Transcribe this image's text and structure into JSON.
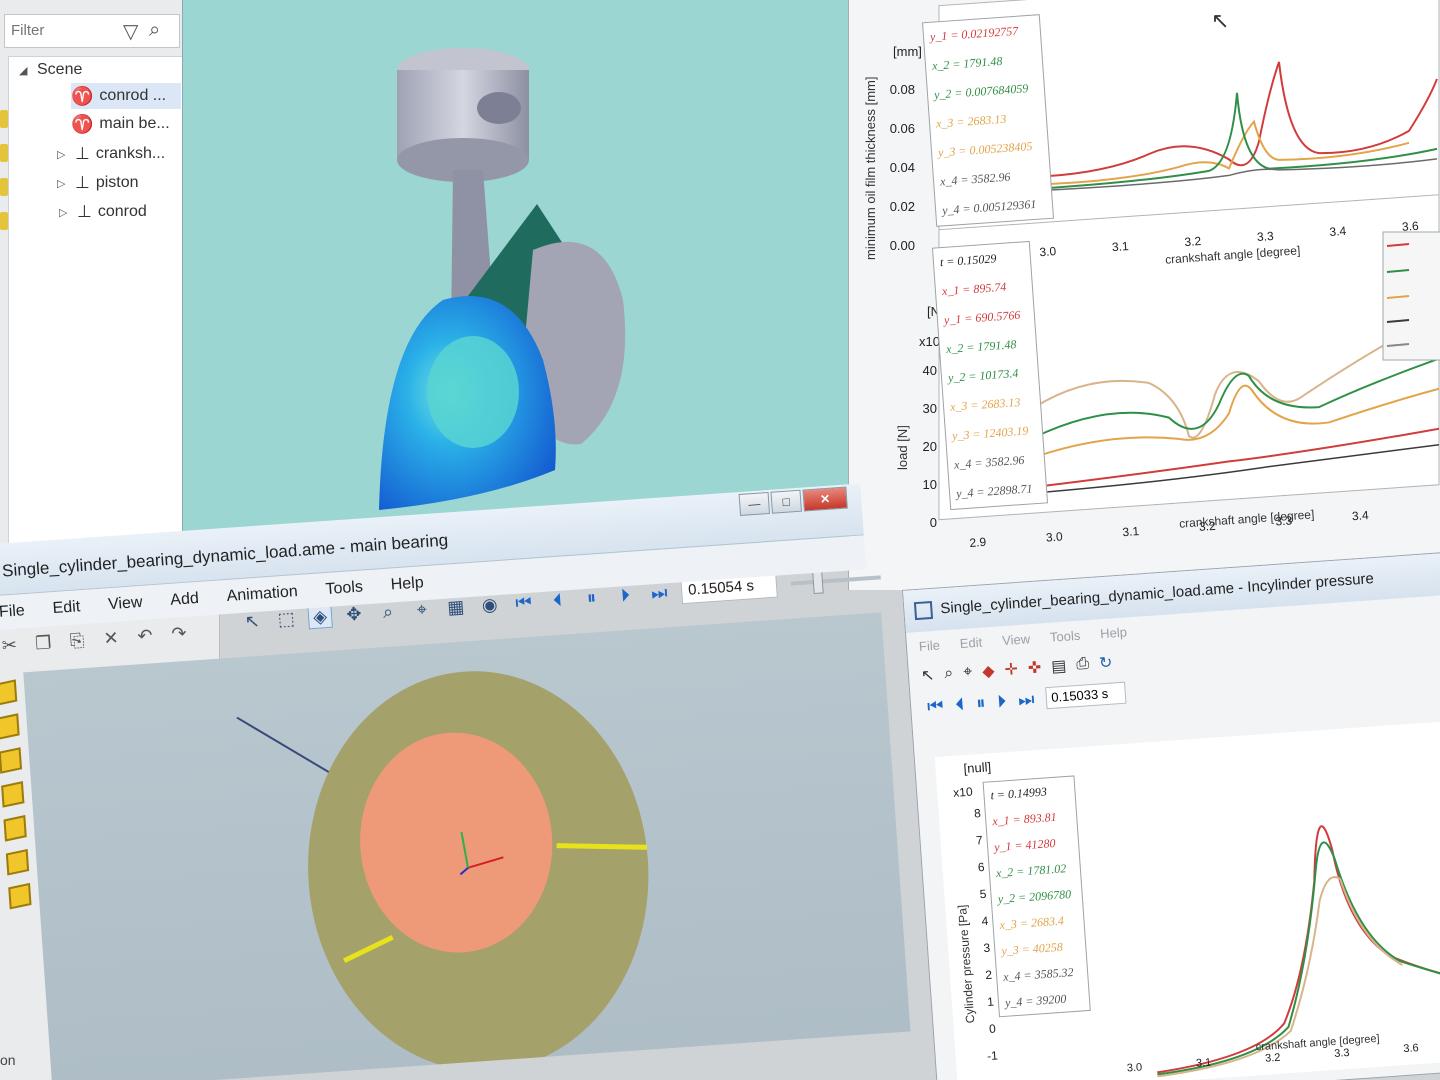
{
  "tree": {
    "filter_placeholder": "Filter",
    "items": [
      {
        "label": "Scene"
      },
      {
        "label": "conrod ..."
      },
      {
        "label": "main be..."
      },
      {
        "label": "cranksh..."
      },
      {
        "label": "piston"
      },
      {
        "label": "conrod"
      }
    ],
    "status": "on"
  },
  "main_window": {
    "title": "Single_cylinder_bearing_dynamic_load.ame - main bearing",
    "menu": [
      "File",
      "Edit",
      "View",
      "Add",
      "Animation",
      "Tools",
      "Help"
    ],
    "time": "0.15054 s",
    "slider_value": 0.28
  },
  "chart_top": {
    "ylabel": "minimum oil film thickness [mm]",
    "unit": "[mm]",
    "yticks": [
      "0.08",
      "0.06",
      "0.04",
      "0.02",
      "0.00"
    ],
    "xticks": [
      "3.0",
      "3.1",
      "3.2",
      "3.3",
      "3.4",
      "3.6"
    ],
    "xlabel": "crankshaft angle [degree]",
    "readout": [
      "y_1 = 0.02192757",
      "x_2 = 1791.48",
      "y_2 = 0.007684059",
      "x_3 = 2683.13",
      "y_3 = 0.005238405",
      "x_4 = 3582.96",
      "y_4 = 0.005129361"
    ]
  },
  "chart_mid": {
    "ylabel": "load [N]",
    "unit": "[N]",
    "scale": "x10",
    "yticks": [
      "40",
      "30",
      "20",
      "10",
      "0"
    ],
    "xticks": [
      "2.9",
      "3.0",
      "3.1",
      "3.2",
      "3.3",
      "3.4"
    ],
    "xlabel": "crankshaft angle [degree]",
    "readout": [
      "t = 0.15029",
      "x_1 = 895.74",
      "y_1 = 690.5766",
      "x_2 = 1791.48",
      "y_2 = 10173.4",
      "x_3 = 2683.13",
      "y_3 = 12403.19",
      "x_4 = 3582.96",
      "y_4 = 22898.71"
    ]
  },
  "pressure_window": {
    "title": "Single_cylinder_bearing_dynamic_load.ame - Incylinder pressure",
    "menu": [
      "File",
      "Edit",
      "View",
      "Tools",
      "Help"
    ],
    "time": "0.15033 s",
    "unit": "[null]",
    "scale": "x10",
    "ylabel": "Cylinder pressure [Pa]",
    "yticks": [
      "8",
      "7",
      "6",
      "5",
      "4",
      "3",
      "2",
      "1",
      "0",
      "-1"
    ],
    "xticks": [
      "3.0",
      "3.1",
      "3.2",
      "3.3",
      "3.6"
    ],
    "xlabel": "crankshaft angle [degree]",
    "readout": [
      "t = 0.14993",
      "x_1 = 893.81",
      "y_1 = 41280",
      "x_2 = 1781.02",
      "y_2 = 2096780",
      "x_3 = 2683.4",
      "y_3 = 40258",
      "x_4 = 3585.32",
      "y_4 = 39200"
    ]
  },
  "colors": {
    "series1": "#d23b3b",
    "series2": "#2f8f47",
    "series3": "#e3a34a",
    "series4": "#6b6b6b"
  }
}
